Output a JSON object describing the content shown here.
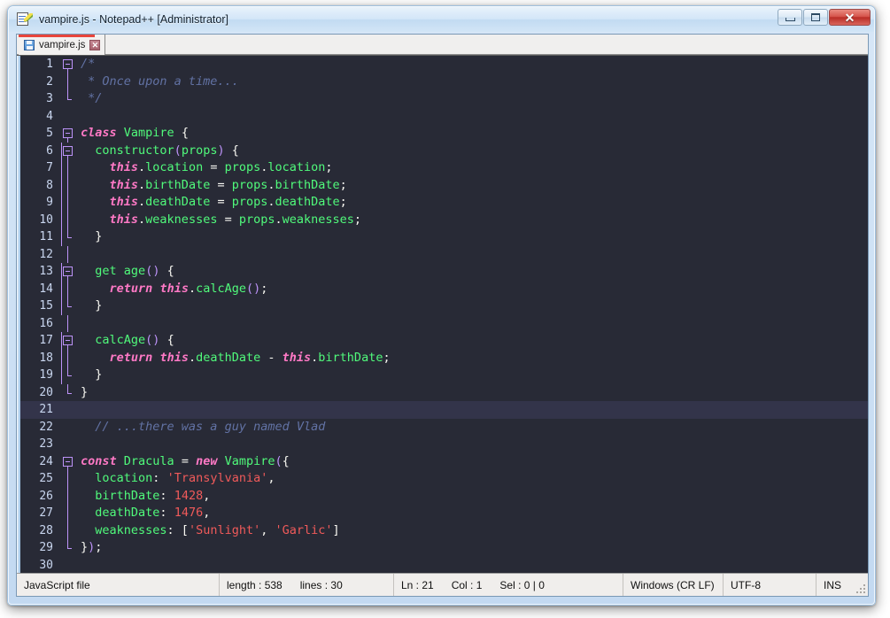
{
  "window": {
    "title": "vampire.js - Notepad++ [Administrator]",
    "app_icon": "notepad-pencil-icon",
    "minimize_label": "",
    "maximize_label": "",
    "close_label": "✕"
  },
  "tab": {
    "label": "vampire.js",
    "save_icon": "floppy-disk-icon",
    "close_label": "✕",
    "accent_color": "#e8453c"
  },
  "editor": {
    "theme_bg": "#282a36",
    "current_line_bg": "#33344a",
    "current_line": 21,
    "total_lines": 30,
    "lines": [
      {
        "n": 1,
        "fold": "box-start",
        "tokens": [
          {
            "t": "com",
            "v": "/*"
          }
        ]
      },
      {
        "n": 2,
        "fold": "line",
        "tokens": [
          {
            "t": "com",
            "v": " * Once upon a time..."
          }
        ]
      },
      {
        "n": 3,
        "fold": "end",
        "tokens": [
          {
            "t": "com",
            "v": " */"
          }
        ]
      },
      {
        "n": 4,
        "fold": "none",
        "tokens": []
      },
      {
        "n": 5,
        "fold": "box-start",
        "tokens": [
          {
            "t": "kw",
            "v": "class"
          },
          {
            "t": "plain",
            "v": " "
          },
          {
            "t": "id",
            "v": "Vampire"
          },
          {
            "t": "plain",
            "v": " {"
          }
        ]
      },
      {
        "n": 6,
        "fold": "box-nested",
        "tokens": [
          {
            "t": "plain",
            "v": "  "
          },
          {
            "t": "id",
            "v": "constructor"
          },
          {
            "t": "punc",
            "v": "("
          },
          {
            "t": "id",
            "v": "props"
          },
          {
            "t": "punc",
            "v": ")"
          },
          {
            "t": "plain",
            "v": " {"
          }
        ]
      },
      {
        "n": 7,
        "fold": "line2",
        "tokens": [
          {
            "t": "plain",
            "v": "    "
          },
          {
            "t": "kw",
            "v": "this"
          },
          {
            "t": "op",
            "v": "."
          },
          {
            "t": "id",
            "v": "location"
          },
          {
            "t": "op",
            "v": " = "
          },
          {
            "t": "id",
            "v": "props"
          },
          {
            "t": "op",
            "v": "."
          },
          {
            "t": "id",
            "v": "location"
          },
          {
            "t": "op",
            "v": ";"
          }
        ]
      },
      {
        "n": 8,
        "fold": "line2",
        "tokens": [
          {
            "t": "plain",
            "v": "    "
          },
          {
            "t": "kw",
            "v": "this"
          },
          {
            "t": "op",
            "v": "."
          },
          {
            "t": "id",
            "v": "birthDate"
          },
          {
            "t": "op",
            "v": " = "
          },
          {
            "t": "id",
            "v": "props"
          },
          {
            "t": "op",
            "v": "."
          },
          {
            "t": "id",
            "v": "birthDate"
          },
          {
            "t": "op",
            "v": ";"
          }
        ]
      },
      {
        "n": 9,
        "fold": "line2",
        "tokens": [
          {
            "t": "plain",
            "v": "    "
          },
          {
            "t": "kw",
            "v": "this"
          },
          {
            "t": "op",
            "v": "."
          },
          {
            "t": "id",
            "v": "deathDate"
          },
          {
            "t": "op",
            "v": " = "
          },
          {
            "t": "id",
            "v": "props"
          },
          {
            "t": "op",
            "v": "."
          },
          {
            "t": "id",
            "v": "deathDate"
          },
          {
            "t": "op",
            "v": ";"
          }
        ]
      },
      {
        "n": 10,
        "fold": "line2",
        "tokens": [
          {
            "t": "plain",
            "v": "    "
          },
          {
            "t": "kw",
            "v": "this"
          },
          {
            "t": "op",
            "v": "."
          },
          {
            "t": "id",
            "v": "weaknesses"
          },
          {
            "t": "op",
            "v": " = "
          },
          {
            "t": "id",
            "v": "props"
          },
          {
            "t": "op",
            "v": "."
          },
          {
            "t": "id",
            "v": "weaknesses"
          },
          {
            "t": "op",
            "v": ";"
          }
        ]
      },
      {
        "n": 11,
        "fold": "end2",
        "tokens": [
          {
            "t": "plain",
            "v": "  }"
          }
        ]
      },
      {
        "n": 12,
        "fold": "line",
        "tokens": []
      },
      {
        "n": 13,
        "fold": "box-nested",
        "tokens": [
          {
            "t": "plain",
            "v": "  "
          },
          {
            "t": "id",
            "v": "get"
          },
          {
            "t": "plain",
            "v": " "
          },
          {
            "t": "id",
            "v": "age"
          },
          {
            "t": "punc",
            "v": "()"
          },
          {
            "t": "plain",
            "v": " {"
          }
        ]
      },
      {
        "n": 14,
        "fold": "line2",
        "tokens": [
          {
            "t": "plain",
            "v": "    "
          },
          {
            "t": "kw",
            "v": "return"
          },
          {
            "t": "plain",
            "v": " "
          },
          {
            "t": "kw",
            "v": "this"
          },
          {
            "t": "op",
            "v": "."
          },
          {
            "t": "id",
            "v": "calcAge"
          },
          {
            "t": "punc",
            "v": "()"
          },
          {
            "t": "op",
            "v": ";"
          }
        ]
      },
      {
        "n": 15,
        "fold": "end2",
        "tokens": [
          {
            "t": "plain",
            "v": "  }"
          }
        ]
      },
      {
        "n": 16,
        "fold": "line",
        "tokens": []
      },
      {
        "n": 17,
        "fold": "box-nested",
        "tokens": [
          {
            "t": "plain",
            "v": "  "
          },
          {
            "t": "id",
            "v": "calcAge"
          },
          {
            "t": "punc",
            "v": "()"
          },
          {
            "t": "plain",
            "v": " {"
          }
        ]
      },
      {
        "n": 18,
        "fold": "line2",
        "tokens": [
          {
            "t": "plain",
            "v": "    "
          },
          {
            "t": "kw",
            "v": "return"
          },
          {
            "t": "plain",
            "v": " "
          },
          {
            "t": "kw",
            "v": "this"
          },
          {
            "t": "op",
            "v": "."
          },
          {
            "t": "id",
            "v": "deathDate"
          },
          {
            "t": "op",
            "v": " - "
          },
          {
            "t": "kw",
            "v": "this"
          },
          {
            "t": "op",
            "v": "."
          },
          {
            "t": "id",
            "v": "birthDate"
          },
          {
            "t": "op",
            "v": ";"
          }
        ]
      },
      {
        "n": 19,
        "fold": "end2",
        "tokens": [
          {
            "t": "plain",
            "v": "  }"
          }
        ]
      },
      {
        "n": 20,
        "fold": "end",
        "tokens": [
          {
            "t": "plain",
            "v": "}"
          }
        ]
      },
      {
        "n": 21,
        "fold": "none",
        "tokens": []
      },
      {
        "n": 22,
        "fold": "none",
        "tokens": [
          {
            "t": "plain",
            "v": "  "
          },
          {
            "t": "com",
            "v": "// ...there was a guy named Vlad"
          }
        ]
      },
      {
        "n": 23,
        "fold": "none",
        "tokens": []
      },
      {
        "n": 24,
        "fold": "box-start",
        "tokens": [
          {
            "t": "kw",
            "v": "const"
          },
          {
            "t": "plain",
            "v": " "
          },
          {
            "t": "id",
            "v": "Dracula"
          },
          {
            "t": "op",
            "v": " = "
          },
          {
            "t": "kw",
            "v": "new"
          },
          {
            "t": "plain",
            "v": " "
          },
          {
            "t": "id",
            "v": "Vampire"
          },
          {
            "t": "punc",
            "v": "("
          },
          {
            "t": "plain",
            "v": "{"
          }
        ]
      },
      {
        "n": 25,
        "fold": "line",
        "tokens": [
          {
            "t": "plain",
            "v": "  "
          },
          {
            "t": "id",
            "v": "location"
          },
          {
            "t": "op",
            "v": ": "
          },
          {
            "t": "str",
            "v": "'Transylvania'"
          },
          {
            "t": "op",
            "v": ","
          }
        ]
      },
      {
        "n": 26,
        "fold": "line",
        "tokens": [
          {
            "t": "plain",
            "v": "  "
          },
          {
            "t": "id",
            "v": "birthDate"
          },
          {
            "t": "op",
            "v": ": "
          },
          {
            "t": "num",
            "v": "1428"
          },
          {
            "t": "op",
            "v": ","
          }
        ]
      },
      {
        "n": 27,
        "fold": "line",
        "tokens": [
          {
            "t": "plain",
            "v": "  "
          },
          {
            "t": "id",
            "v": "deathDate"
          },
          {
            "t": "op",
            "v": ": "
          },
          {
            "t": "num",
            "v": "1476"
          },
          {
            "t": "op",
            "v": ","
          }
        ]
      },
      {
        "n": 28,
        "fold": "line",
        "tokens": [
          {
            "t": "plain",
            "v": "  "
          },
          {
            "t": "id",
            "v": "weaknesses"
          },
          {
            "t": "op",
            "v": ": ["
          },
          {
            "t": "str",
            "v": "'Sunlight'"
          },
          {
            "t": "op",
            "v": ", "
          },
          {
            "t": "str",
            "v": "'Garlic'"
          },
          {
            "t": "op",
            "v": "]"
          }
        ]
      },
      {
        "n": 29,
        "fold": "end",
        "tokens": [
          {
            "t": "plain",
            "v": "}"
          },
          {
            "t": "punc",
            "v": ")"
          },
          {
            "t": "op",
            "v": ";"
          }
        ]
      },
      {
        "n": 30,
        "fold": "none",
        "tokens": []
      }
    ]
  },
  "statusbar": {
    "file_type": "JavaScript file",
    "length": "length : 538",
    "lines": "lines : 30",
    "ln": "Ln : 21",
    "col": "Col : 1",
    "sel": "Sel : 0 | 0",
    "eol": "Windows (CR LF)",
    "encoding": "UTF-8",
    "insert_mode": "INS"
  }
}
